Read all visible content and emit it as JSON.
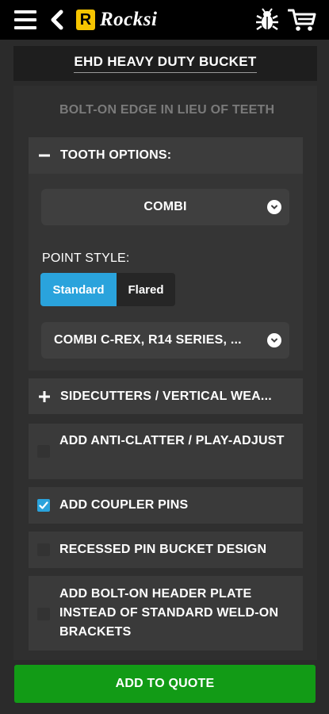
{
  "header": {
    "logo_letter": "R",
    "logo_text": "Rocksi"
  },
  "product": {
    "title": "EHD HEAVY DUTY BUCKET"
  },
  "options": {
    "bolt_on_edge": "BOLT-ON EDGE IN LIEU OF TEETH",
    "tooth_options": {
      "label": "TOOTH OPTIONS:",
      "expanded": true,
      "system_select": "COMBI",
      "point_style_label": "POINT STYLE:",
      "point_styles": [
        "Standard",
        "Flared"
      ],
      "selected_point_style": "Standard",
      "series_select": "COMBI C-REX, R14 SERIES, ..."
    },
    "sidecutters": {
      "label": "SIDECUTTERS / VERTICAL WEA...",
      "expanded": false
    },
    "checkboxes": [
      {
        "label": "ADD ANTI-CLATTER / PLAY-ADJUST",
        "checked": false
      },
      {
        "label": "ADD COUPLER PINS",
        "checked": true
      },
      {
        "label": "RECESSED PIN BUCKET DESIGN",
        "checked": false
      },
      {
        "label": "ADD BOLT-ON HEADER PLATE INSTEAD OF STANDARD WELD-ON BRACKETS",
        "checked": false
      }
    ]
  },
  "actions": {
    "add_to_quote": "ADD TO QUOTE"
  },
  "colors": {
    "accent_blue": "#2aa3dc",
    "quote_green": "#129b16",
    "logo_yellow": "#f6c400"
  },
  "icons": [
    "menu-icon",
    "back-icon",
    "bug-icon",
    "cart-icon",
    "minus-icon",
    "plus-icon",
    "chevron-down-icon"
  ]
}
